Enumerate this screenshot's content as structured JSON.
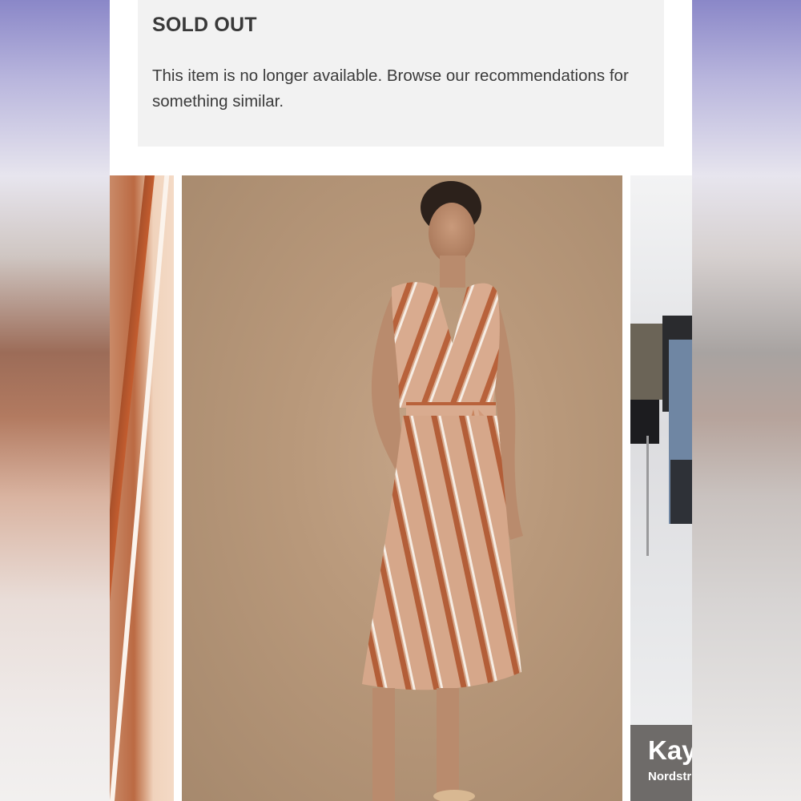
{
  "notice": {
    "title": "SOLD OUT",
    "message": "This item is no longer available. Browse our recommendations for something similar."
  },
  "gallery": {
    "right_thumb_caption_line1": "Kay",
    "right_thumb_caption_line2": "Nordstr"
  },
  "colors": {
    "notice_background": "#f2f2f2",
    "title_text": "#393939",
    "body_text": "#3b3b3b"
  }
}
